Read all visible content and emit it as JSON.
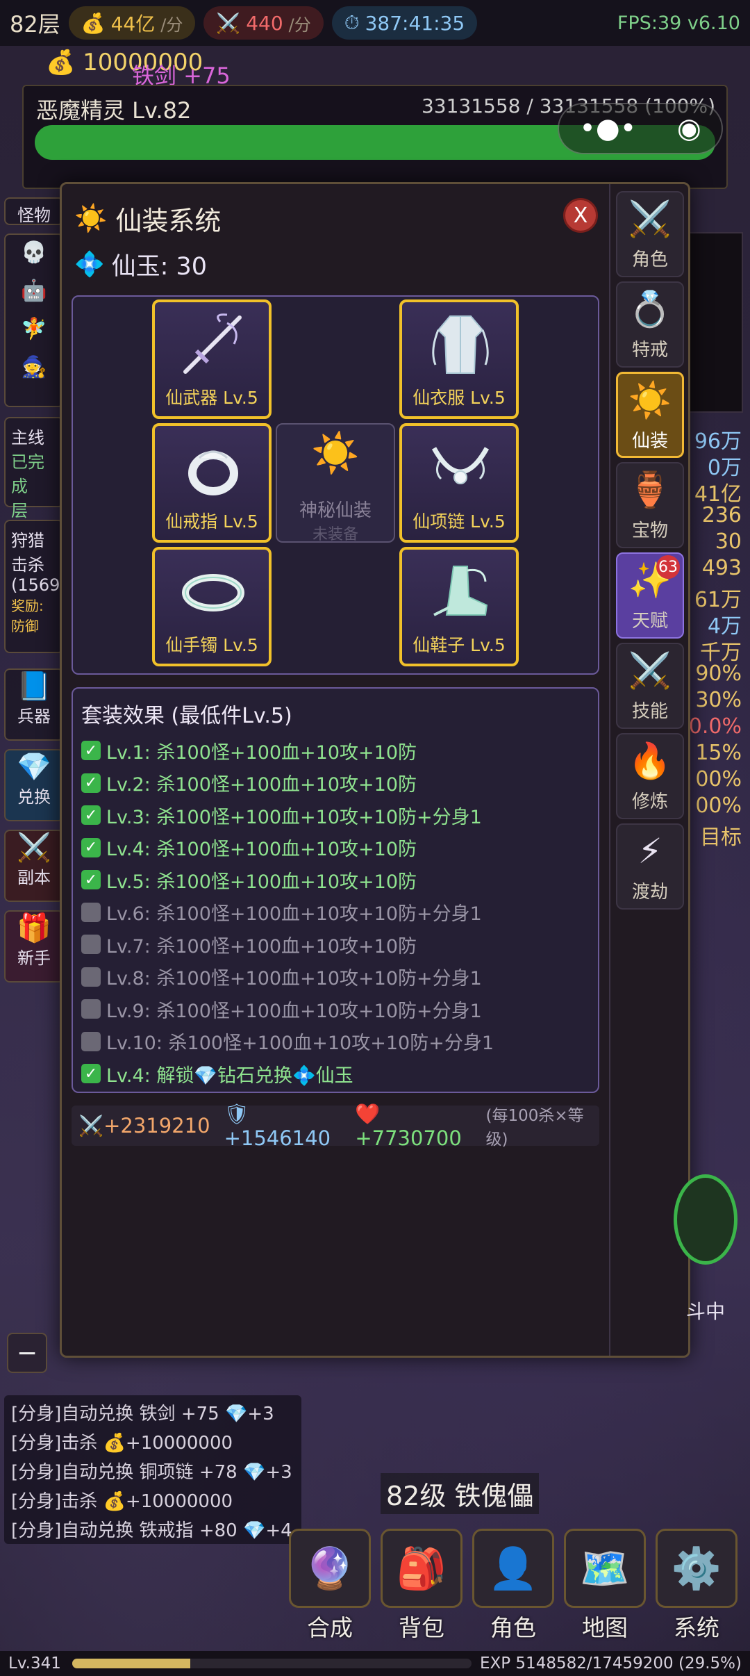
{
  "top": {
    "floor": "82层",
    "gold_rate": "44亿",
    "gold_unit": "/分",
    "kill_rate": "440",
    "kill_unit": "/分",
    "timer": "387:41:35",
    "fps": "FPS:39 v6.10"
  },
  "gold_total": "10000000",
  "float_text": "铁剑 +75",
  "boss": {
    "name": "恶魔精灵 Lv.82",
    "hp": "33131558 / 33131558 (100%)",
    "hp_fraction": 1.0
  },
  "left_tabs": {
    "monster": "怪物",
    "quest_title": "主线",
    "quest_done": "已完成",
    "quest_floor": "层",
    "hunt": "狩猎",
    "hunt_kill": "击杀",
    "hunt_count": "(1569",
    "reward": "奖励:",
    "defense": "防御",
    "weapon": "兵器",
    "exchange": "兑换",
    "dungeon": "副本",
    "newbie": "新手"
  },
  "right_values": [
    "96万",
    "0万",
    "41亿",
    "236",
    "30",
    "493",
    "61万",
    "4万",
    "千万",
    "90%",
    "30%",
    "0.0%",
    "15%",
    "00%",
    "00%",
    "目标"
  ],
  "modal": {
    "title": "仙装系统",
    "currency_label": "仙玉: 30",
    "close_label": "X",
    "slots": [
      {
        "name": "仙武器 Lv.5",
        "icon": "immortal-sword-icon"
      },
      {
        "name": "仙衣服 Lv.5",
        "icon": "immortal-robe-icon"
      },
      {
        "name": "仙戒指 Lv.5",
        "icon": "immortal-ring-icon"
      },
      {
        "name": "仙项链 Lv.5",
        "icon": "immortal-necklace-icon"
      },
      {
        "name": "仙手镯 Lv.5",
        "icon": "immortal-bracelet-icon"
      },
      {
        "name": "仙鞋子 Lv.5",
        "icon": "immortal-boots-icon"
      }
    ],
    "mystery_slot": {
      "name": "神秘仙装",
      "status": "未装备"
    },
    "set_title": "套装效果 (最低件Lv.5)",
    "set_effects": [
      {
        "text": "Lv.1: 杀100怪+100血+10攻+10防",
        "unlocked": true
      },
      {
        "text": "Lv.2: 杀100怪+100血+10攻+10防",
        "unlocked": true
      },
      {
        "text": "Lv.3: 杀100怪+100血+10攻+10防+分身1",
        "unlocked": true
      },
      {
        "text": "Lv.4: 杀100怪+100血+10攻+10防",
        "unlocked": true
      },
      {
        "text": "Lv.5: 杀100怪+100血+10攻+10防",
        "unlocked": true
      },
      {
        "text": "Lv.6: 杀100怪+100血+10攻+10防+分身1",
        "unlocked": false
      },
      {
        "text": "Lv.7: 杀100怪+100血+10攻+10防",
        "unlocked": false
      },
      {
        "text": "Lv.8: 杀100怪+100血+10攻+10防+分身1",
        "unlocked": false
      },
      {
        "text": "Lv.9: 杀100怪+100血+10攻+10防+分身1",
        "unlocked": false
      },
      {
        "text": "Lv.10: 杀100怪+100血+10攻+10防+分身1",
        "unlocked": false
      },
      {
        "text": "Lv.4: 解锁💎钻石兑换💠仙玉",
        "unlocked": true
      }
    ],
    "stats": {
      "atk": "+2319210",
      "def": "+1546140",
      "hp": "+7730700",
      "note": "(每100杀×等级)"
    },
    "side_tabs": [
      {
        "label": "角色",
        "icon": "crossed-swords-icon"
      },
      {
        "label": "特戒",
        "icon": "ring-icon"
      },
      {
        "label": "仙装",
        "icon": "sun-icon",
        "active": true
      },
      {
        "label": "宝物",
        "icon": "urn-icon"
      },
      {
        "label": "天赋",
        "icon": "sparkles-icon",
        "badge": "63"
      },
      {
        "label": "技能",
        "icon": "crossed-swords-icon"
      },
      {
        "label": "修炼",
        "icon": "fire-icon"
      },
      {
        "label": "渡劫",
        "icon": "lightning-icon"
      }
    ]
  },
  "minus_label": "−",
  "logs": [
    "[分身]自动兑换 铁剑 +75 💎+3",
    "[分身]击杀 💰+10000000",
    "[分身]自动兑换 铜项链 +78 💎+3",
    "[分身]击杀 💰+10000000",
    "[分身]自动兑换 铁戒指 +80 💎+4"
  ],
  "enemy_label": "82级 铁傀儡",
  "battle_label": "斗中",
  "nav": [
    {
      "label": "合成",
      "icon": "crystal-ball-icon"
    },
    {
      "label": "背包",
      "icon": "backpack-icon"
    },
    {
      "label": "角色",
      "icon": "person-icon"
    },
    {
      "label": "地图",
      "icon": "map-icon"
    },
    {
      "label": "系统",
      "icon": "gear-icon"
    }
  ],
  "player_level": "Lv.341",
  "exp": "EXP 5148582/17459200 (29.5%)",
  "exp_fraction": 0.295
}
